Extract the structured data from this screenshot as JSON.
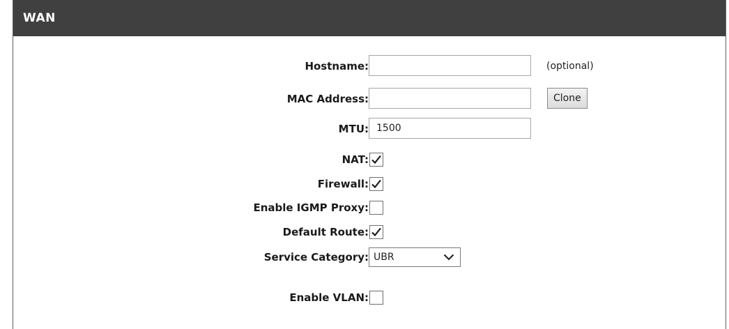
{
  "panel": {
    "title": "WAN"
  },
  "form": {
    "hostname": {
      "label": "Hostname:",
      "value": "",
      "hint": "(optional)"
    },
    "mac_address": {
      "label": "MAC Address:",
      "value": "",
      "clone_label": "Clone"
    },
    "mtu": {
      "label": "MTU:",
      "value": "1500"
    },
    "nat": {
      "label": "NAT:",
      "checked": true
    },
    "firewall": {
      "label": "Firewall:",
      "checked": true
    },
    "igmp_proxy": {
      "label": "Enable IGMP Proxy:",
      "checked": false
    },
    "default_route": {
      "label": "Default Route:",
      "checked": true
    },
    "service_category": {
      "label": "Service Category:",
      "selected": "UBR"
    },
    "vlan": {
      "label": "Enable VLAN:",
      "checked": false
    }
  },
  "icons": {
    "check": "checkmark-icon",
    "dropdown": "chevron-down-icon"
  }
}
